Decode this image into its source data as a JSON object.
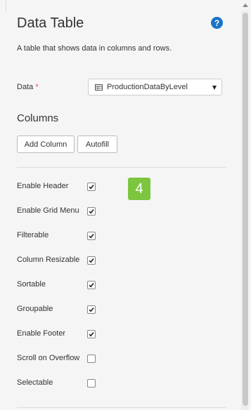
{
  "panel": {
    "title": "Data Table",
    "description": "A table that shows data in columns and rows."
  },
  "data_field": {
    "label": "Data",
    "required_marker": "*",
    "selected_value": "ProductionDataByLevel"
  },
  "columns": {
    "heading": "Columns",
    "add_column_label": "Add Column",
    "autofill_label": "Autofill"
  },
  "step_badge": "4",
  "options": [
    {
      "label": "Enable Header",
      "checked": true
    },
    {
      "label": "Enable Grid Menu",
      "checked": true
    },
    {
      "label": "Filterable",
      "checked": true
    },
    {
      "label": "Column Resizable",
      "checked": true
    },
    {
      "label": "Sortable",
      "checked": true
    },
    {
      "label": "Groupable",
      "checked": true
    },
    {
      "label": "Enable Footer",
      "checked": true
    },
    {
      "label": "Scroll on Overflow",
      "checked": false
    },
    {
      "label": "Selectable",
      "checked": false
    }
  ],
  "colors": {
    "badge": "#7cc63f",
    "help_icon": "#1a73c6",
    "required": "#d9534f"
  }
}
